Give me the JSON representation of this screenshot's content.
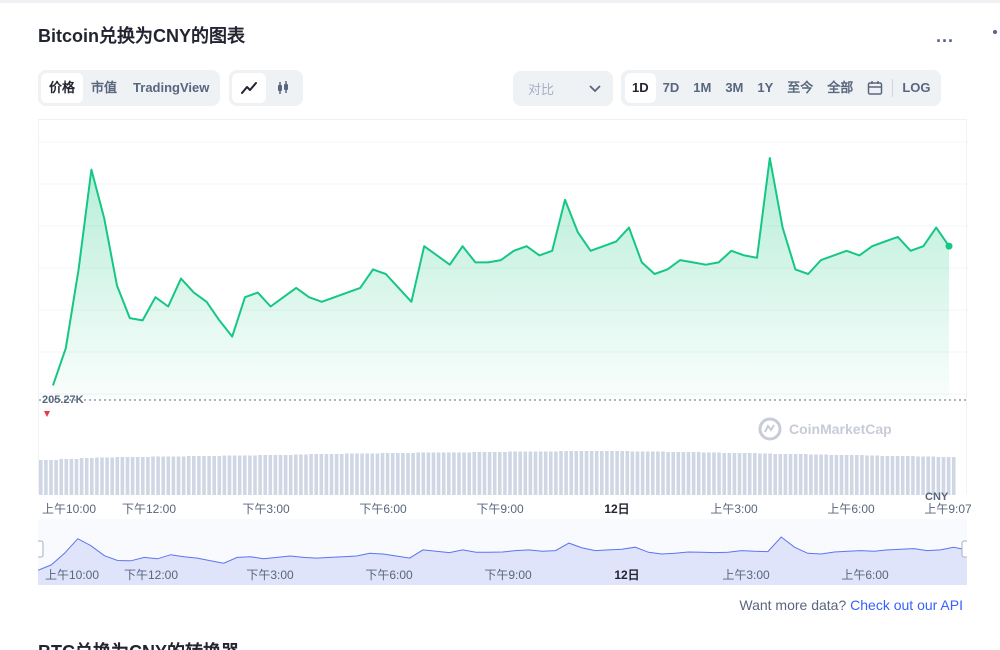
{
  "header": {
    "title": "Bitcoin兑换为CNY的图表",
    "more_label": "..."
  },
  "view_tabs": [
    "价格",
    "市值",
    "TradingView"
  ],
  "active_view": 0,
  "chart_type_icons": [
    "line-chart-icon",
    "candlestick-icon"
  ],
  "compare": {
    "label": "对比"
  },
  "range_tabs": [
    "1D",
    "7D",
    "1M",
    "3M",
    "1Y",
    "至今",
    "全部"
  ],
  "active_range": 0,
  "log_label": "LOG",
  "watermark": "CoinMarketCap",
  "currency_label": "CNY",
  "last_price_label": "205.27K",
  "colors": {
    "line": "#16c784",
    "down": "#ea3943",
    "accent": "#3861fb",
    "volume": "#cfd6e4",
    "nav": "#c5cdf9"
  },
  "chart_data": {
    "type": "area",
    "x": [
      "上午10:00",
      "上午12:00",
      "下午3:00",
      "下午6:00",
      "下午9:00",
      "12日",
      "上午3:00",
      "上午6:00",
      "上午9:07"
    ],
    "x_tick_labels": [
      "上午10:00",
      "下午12:00",
      "下午3:00",
      "下午6:00",
      "下午9:00",
      "12日",
      "上午3:00",
      "上午6:00",
      "上午9:07"
    ],
    "nav_tick_labels": [
      "上午10:00",
      "下午12:00",
      "下午3:00",
      "下午6:00",
      "下午9:00",
      "12日",
      "上午3:00",
      "上午6:00"
    ],
    "series": [
      {
        "values": [
          0.02,
          0.18,
          0.52,
          0.95,
          0.74,
          0.45,
          0.31,
          0.3,
          0.4,
          0.36,
          0.48,
          0.42,
          0.38,
          0.3,
          0.23,
          0.4,
          0.42,
          0.36,
          0.4,
          0.44,
          0.4,
          0.38,
          0.4,
          0.42,
          0.44,
          0.52,
          0.5,
          0.44,
          0.38,
          0.62,
          0.58,
          0.54,
          0.62,
          0.55,
          0.55,
          0.56,
          0.6,
          0.62,
          0.58,
          0.6,
          0.82,
          0.68,
          0.6,
          0.62,
          0.64,
          0.7,
          0.55,
          0.5,
          0.52,
          0.56,
          0.55,
          0.54,
          0.55,
          0.6,
          0.58,
          0.57,
          1.0,
          0.7,
          0.52,
          0.5,
          0.56,
          0.58,
          0.6,
          0.58,
          0.62,
          0.64,
          0.66,
          0.6,
          0.62,
          0.7,
          0.62
        ]
      }
    ],
    "volume": [
      0.7,
      0.72,
      0.74,
      0.75,
      0.76,
      0.76,
      0.77,
      0.77,
      0.78,
      0.78,
      0.79,
      0.79,
      0.8,
      0.8,
      0.81,
      0.82,
      0.82,
      0.83,
      0.83,
      0.84,
      0.84,
      0.85,
      0.85,
      0.85,
      0.86,
      0.86,
      0.87,
      0.87,
      0.87,
      0.88,
      0.88,
      0.88,
      0.88,
      0.87,
      0.87,
      0.86,
      0.86,
      0.85,
      0.84,
      0.84,
      0.83,
      0.82,
      0.82,
      0.81,
      0.8,
      0.8,
      0.79,
      0.78,
      0.78,
      0.77,
      0.76,
      0.76
    ],
    "baseline_label": "205.27K",
    "ylabel": "",
    "grid": true
  },
  "footer": {
    "more_data_prefix": "Want more data?",
    "more_data_link": "Check out our API",
    "converter_title": "BTC兑换为CNY的转换器"
  }
}
